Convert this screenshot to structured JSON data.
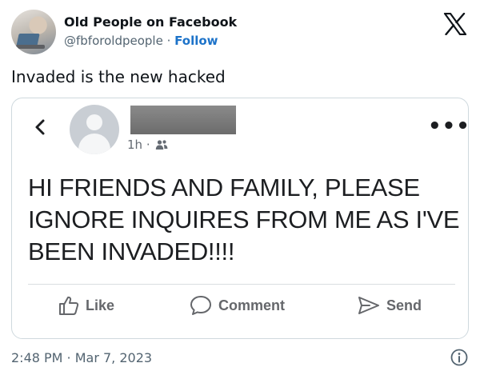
{
  "author": {
    "name": "Old People on Facebook",
    "handle": "@fbforoldpeople",
    "separator": " · ",
    "follow_label": "Follow"
  },
  "tweet": {
    "text": "Invaded is the new hacked",
    "timestamp": "2:48 PM · Mar 7, 2023"
  },
  "embedded_post": {
    "meta_time": "1h ·",
    "text": "HI FRIENDS AND FAMILY,  PLEASE IGNORE INQUIRES FROM ME AS I'VE BEEN INVADED!!!!",
    "actions": {
      "like": "Like",
      "comment": "Comment",
      "send": "Send"
    }
  },
  "icons": {
    "logo": "x-logo-icon",
    "back": "chevron-left-icon",
    "privacy": "friends-icon",
    "more": "more-dots-icon",
    "like": "thumbs-up-icon",
    "comment": "comment-bubble-icon",
    "send": "send-icon",
    "info": "info-icon"
  },
  "colors": {
    "follow": "#1d73c9",
    "secondary_text": "#536471",
    "fb_action_text": "#65676b"
  }
}
